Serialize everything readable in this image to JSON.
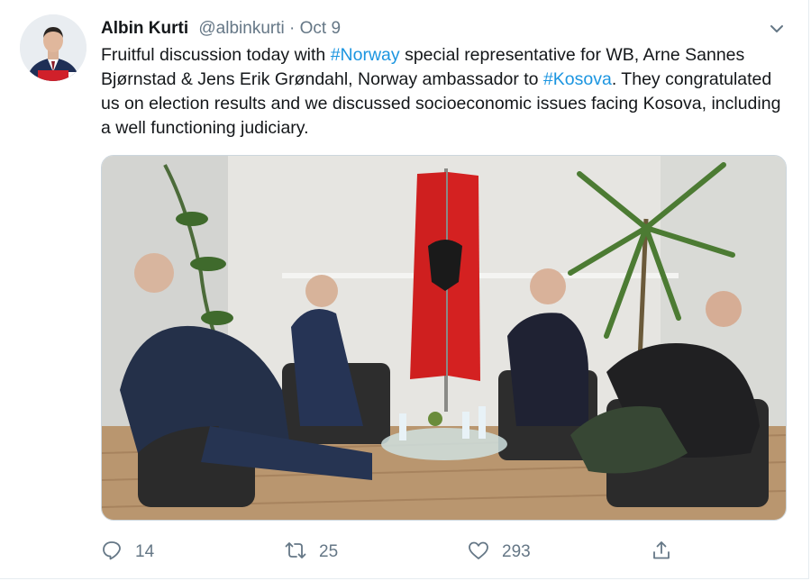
{
  "author": {
    "name": "Albin Kurti",
    "handle": "@albinkurti",
    "separator": "·",
    "date": "Oct 9"
  },
  "tweet": {
    "t1": "Fruitful discussion today with ",
    "tag_norway": "#Norway",
    "t2": " special representative for WB, Arne Sannes Bjørnstad & Jens Erik Grøndahl, Norway ambassador to ",
    "tag_kosova": "#Kosova",
    "t3": ". They congratulated us on election results and we discussed socioeconomic issues facing Kosova, including a well functioning judiciary."
  },
  "actions": {
    "replies": "14",
    "retweets": "25",
    "likes": "293"
  },
  "colors": {
    "link": "#1b95e0",
    "muted": "#657786",
    "flag_red": "#d42121"
  },
  "icons": [
    "chevron-down-icon",
    "reply-icon",
    "retweet-icon",
    "like-icon",
    "share-icon"
  ]
}
